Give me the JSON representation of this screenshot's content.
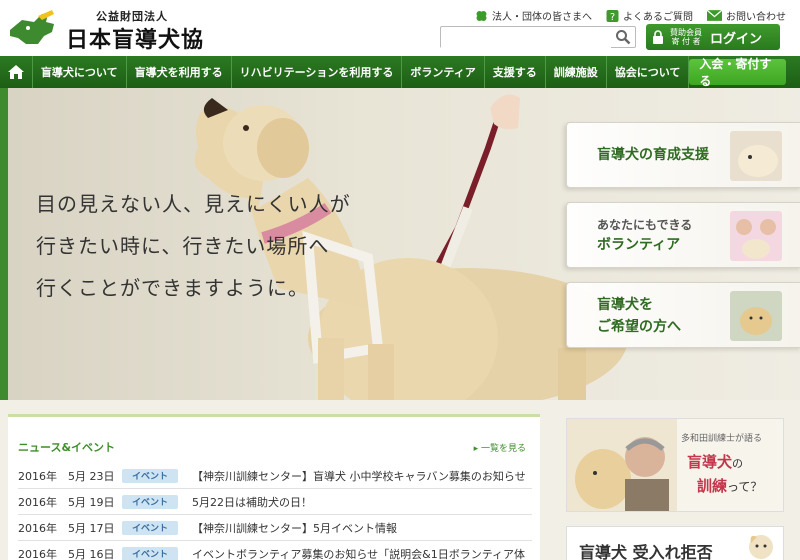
{
  "header": {
    "org_sub": "公益財団法人",
    "org_name": "日本盲導犬協会",
    "links": [
      "法人・団体の皆さまへ",
      "よくあるご質問",
      "お問い合わせ"
    ],
    "search_placeholder": "",
    "login_small_1": "賛助会員",
    "login_small_2": "寄 付 者",
    "login_label": "ログイン"
  },
  "nav": {
    "items": [
      "盲導犬について",
      "盲導犬を利用する",
      "リハビリテーションを利用する",
      "ボランティア",
      "支援する",
      "訓練施設",
      "協会について"
    ],
    "join": "入会・寄付する"
  },
  "hero": {
    "lines": [
      "目の見えない人、見えにくい人が",
      "行きたい時に、行きたい場所へ",
      "行くことができますように。"
    ],
    "promos": [
      {
        "line1": "盲導犬の育成支援",
        "line2": ""
      },
      {
        "line1": "あなたにもできる",
        "line2": "ボランティア"
      },
      {
        "line1": "盲導犬を",
        "line2": "ご希望の方へ"
      }
    ]
  },
  "news": {
    "heading": "ニュース&イベント",
    "more": "一覧を見る",
    "rows": [
      {
        "date": "2016年　5月 23日",
        "badge": "イベント",
        "title": "【神奈川訓練センター】盲導犬 小中学校キャラバン募集のお知らせ"
      },
      {
        "date": "2016年　5月 19日",
        "badge": "イベント",
        "title": "5月22日は補助犬の日！"
      },
      {
        "date": "2016年　5月 17日",
        "badge": "イベント",
        "title": "【神奈川訓練センター】5月イベント情報"
      },
      {
        "date": "2016年　5月 16日",
        "badge": "イベント",
        "title": "イベントボランティア募集のお知らせ「説明会&1日ボランティア体"
      }
    ]
  },
  "side": {
    "banner1_top": "多和田訓練士が語る",
    "banner1_main1": "盲導犬",
    "banner1_no": "の",
    "banner1_main2": "訓練",
    "banner1_tail": "って？",
    "banner2": "盲導犬 受入れ拒否"
  },
  "colors": {
    "brand_green": "#2c7a22",
    "accent_green": "#3f9a2d",
    "badge_blue": "#cfe4f2"
  }
}
